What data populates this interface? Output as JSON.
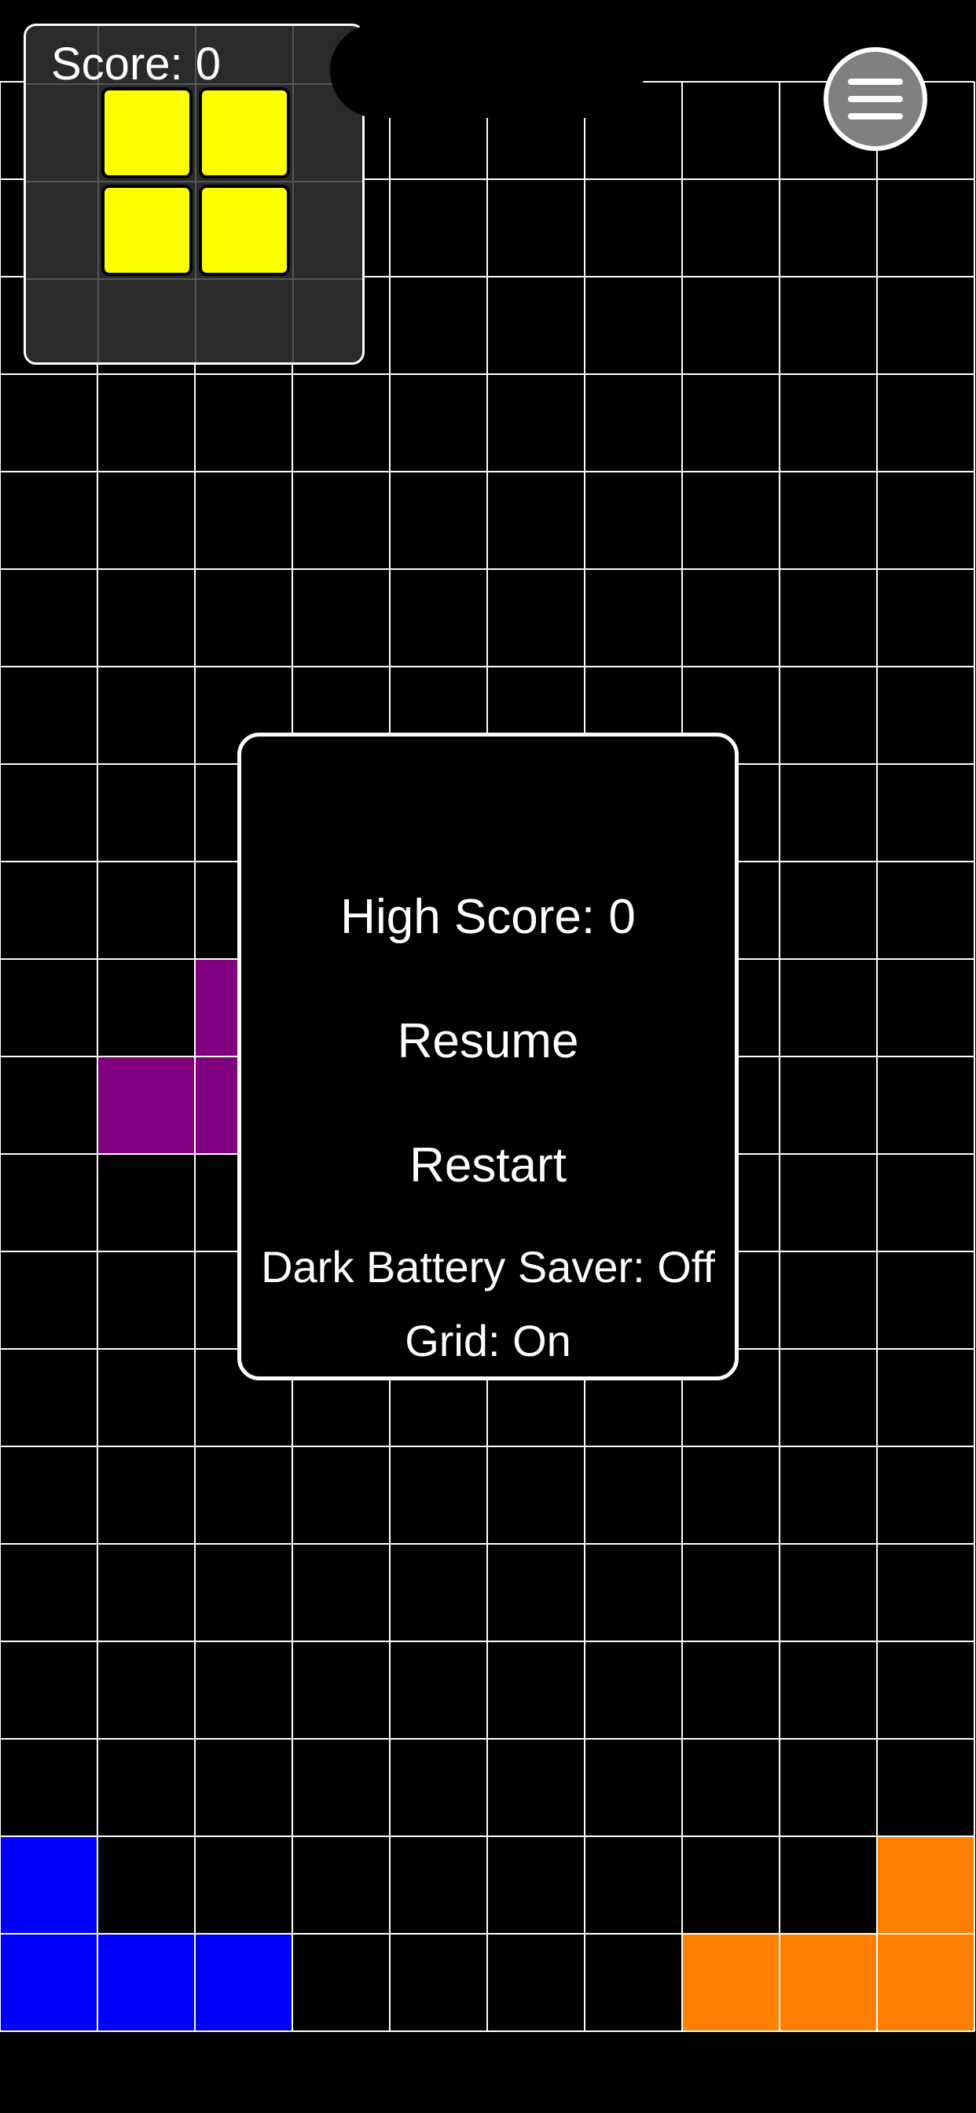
{
  "hud": {
    "score_label": "Score: 0"
  },
  "next_piece": {
    "shape": "O",
    "color": "#ffff00",
    "cells": [
      [
        0,
        0
      ],
      [
        1,
        0
      ],
      [
        0,
        1
      ],
      [
        1,
        1
      ]
    ]
  },
  "menu_button": {
    "icon": "hamburger-menu-icon"
  },
  "board": {
    "columns": 10,
    "rows": 20,
    "grid": "on",
    "grid_color": "#ffffff",
    "background": "#000000",
    "blocks": [
      {
        "piece": "T",
        "color": "#800080",
        "col": 2,
        "row": 9
      },
      {
        "piece": "T",
        "color": "#800080",
        "col": 1,
        "row": 10
      },
      {
        "piece": "T",
        "color": "#800080",
        "col": 2,
        "row": 10
      },
      {
        "piece": "J",
        "color": "#0000ff",
        "col": 0,
        "row": 18
      },
      {
        "piece": "J",
        "color": "#0000ff",
        "col": 0,
        "row": 19
      },
      {
        "piece": "J",
        "color": "#0000ff",
        "col": 1,
        "row": 19
      },
      {
        "piece": "J",
        "color": "#0000ff",
        "col": 2,
        "row": 19
      },
      {
        "piece": "L",
        "color": "#ff8000",
        "col": 9,
        "row": 18
      },
      {
        "piece": "L",
        "color": "#ff8000",
        "col": 7,
        "row": 19
      },
      {
        "piece": "L",
        "color": "#ff8000",
        "col": 8,
        "row": 19
      },
      {
        "piece": "L",
        "color": "#ff8000",
        "col": 9,
        "row": 19
      }
    ]
  },
  "pause_menu": {
    "high_score_label": "High Score: 0",
    "resume_label": "Resume",
    "restart_label": "Restart",
    "battery_saver_label": "Dark Battery Saver: Off",
    "grid_label": "Grid: On"
  }
}
